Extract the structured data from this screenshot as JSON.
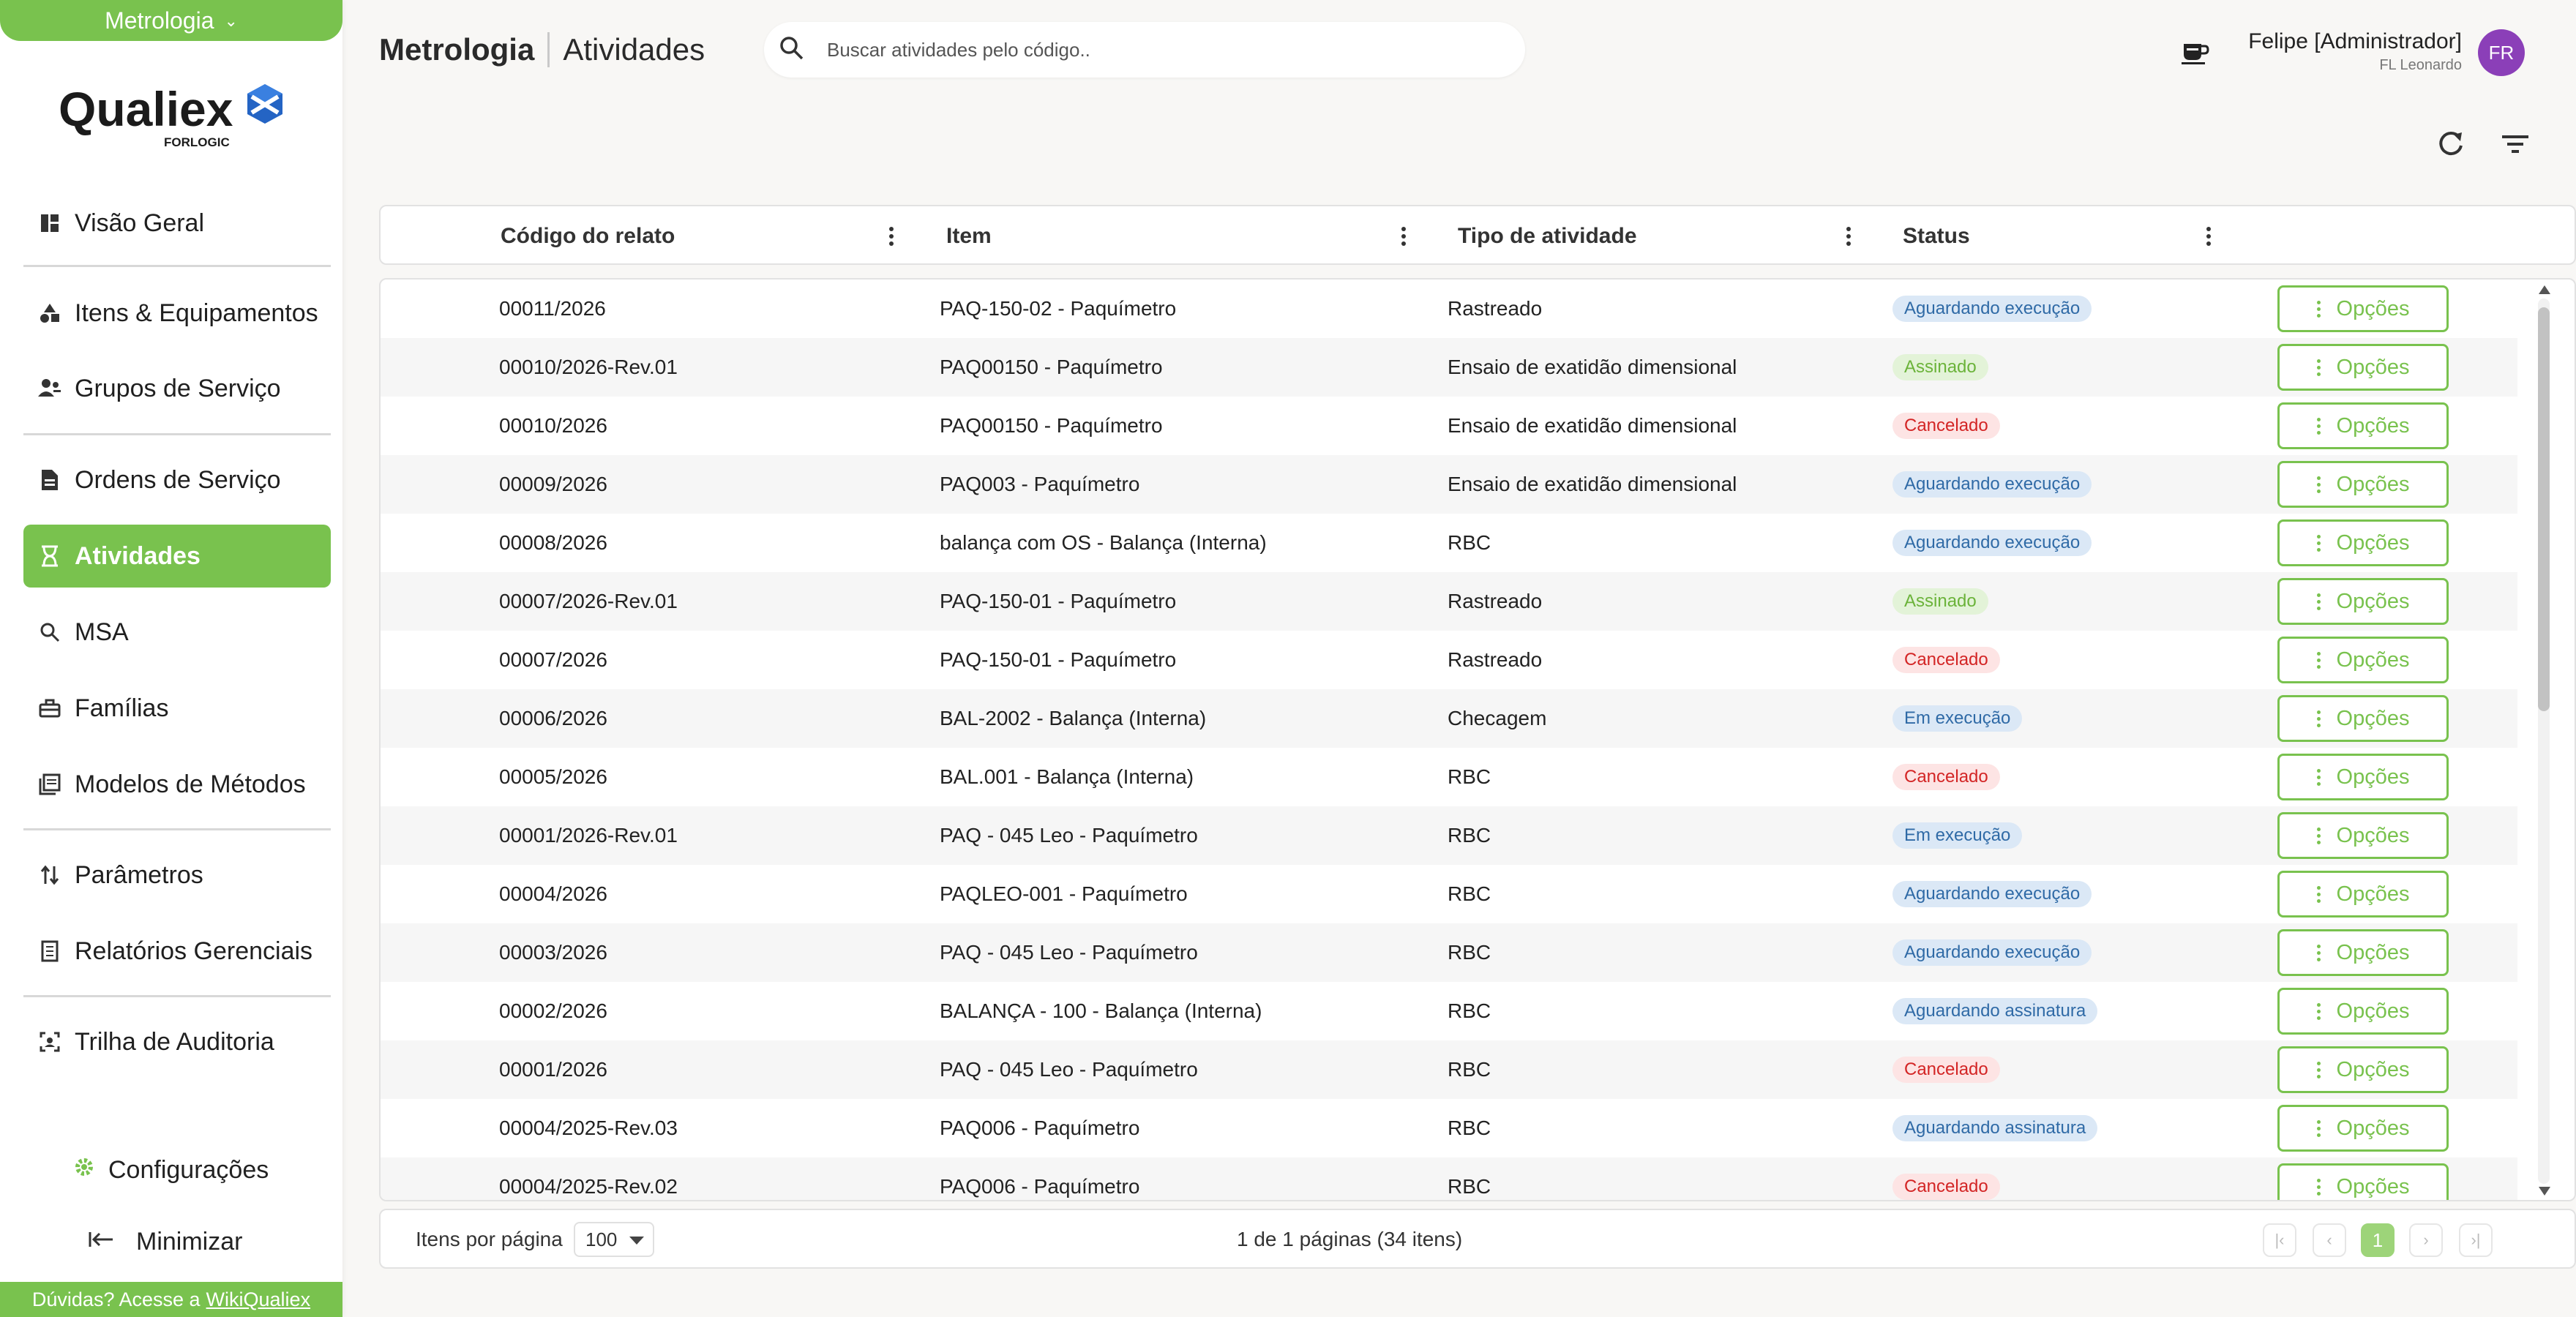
{
  "sidebar": {
    "module_label": "Metrologia",
    "logo": {
      "name": "Qualiex",
      "sub": "FORLOGIC"
    },
    "items": [
      {
        "label": "Visão Geral",
        "icon": "dashboard-icon"
      },
      {
        "label": "Itens & Equipamentos",
        "icon": "shapes-icon"
      },
      {
        "label": "Grupos de Serviço",
        "icon": "group-icon"
      },
      {
        "label": "Ordens de Serviço",
        "icon": "document-icon"
      },
      {
        "label": "Atividades",
        "icon": "hourglass-icon"
      },
      {
        "label": "MSA",
        "icon": "magnify-icon"
      },
      {
        "label": "Famílias",
        "icon": "toolbox-icon"
      },
      {
        "label": "Modelos de Métodos",
        "icon": "library-icon"
      },
      {
        "label": "Parâmetros",
        "icon": "sort-arrows-icon"
      },
      {
        "label": "Relatórios Gerenciais",
        "icon": "report-icon"
      },
      {
        "label": "Trilha de Auditoria",
        "icon": "audit-icon"
      }
    ],
    "active_item": "Atividades",
    "settings_label": "Configurações",
    "minimize_label": "Minimizar",
    "help_text": "Dúvidas? Acesse a",
    "help_link": "WikiQualiex"
  },
  "header": {
    "module": "Metrologia",
    "page": "Atividades",
    "search_placeholder": "Buscar atividades pelo código..",
    "user_name": "Felipe [Administrador]",
    "user_company": "FL Leonardo",
    "avatar_initials": "FR"
  },
  "table": {
    "columns": [
      "Código do relato",
      "Item",
      "Tipo de atividade",
      "Status"
    ],
    "option_label": "Opções",
    "rows": [
      {
        "code": "00011/2026",
        "item": "PAQ-150-02 - Paquímetro",
        "type": "Rastreado",
        "status": "Aguardando execução",
        "status_kind": "aguardando"
      },
      {
        "code": "00010/2026-Rev.01",
        "item": "PAQ00150 - Paquímetro",
        "type": "Ensaio de exatidão dimensional",
        "status": "Assinado",
        "status_kind": "assinado"
      },
      {
        "code": "00010/2026",
        "item": "PAQ00150 - Paquímetro",
        "type": "Ensaio de exatidão dimensional",
        "status": "Cancelado",
        "status_kind": "cancelado"
      },
      {
        "code": "00009/2026",
        "item": "PAQ003 - Paquímetro",
        "type": "Ensaio de exatidão dimensional",
        "status": "Aguardando execução",
        "status_kind": "aguardando"
      },
      {
        "code": "00008/2026",
        "item": "balança com OS - Balança (Interna)",
        "type": "RBC",
        "status": "Aguardando execução",
        "status_kind": "aguardando"
      },
      {
        "code": "00007/2026-Rev.01",
        "item": "PAQ-150-01 - Paquímetro",
        "type": "Rastreado",
        "status": "Assinado",
        "status_kind": "assinado"
      },
      {
        "code": "00007/2026",
        "item": "PAQ-150-01 - Paquímetro",
        "type": "Rastreado",
        "status": "Cancelado",
        "status_kind": "cancelado"
      },
      {
        "code": "00006/2026",
        "item": "BAL-2002 - Balança (Interna)",
        "type": "Checagem",
        "status": "Em execução",
        "status_kind": "execucao"
      },
      {
        "code": "00005/2026",
        "item": "BAL.001 - Balança (Interna)",
        "type": "RBC",
        "status": "Cancelado",
        "status_kind": "cancelado"
      },
      {
        "code": "00001/2026-Rev.01",
        "item": "PAQ - 045 Leo - Paquímetro",
        "type": "RBC",
        "status": "Em execução",
        "status_kind": "execucao"
      },
      {
        "code": "00004/2026",
        "item": "PAQLEO-001 - Paquímetro",
        "type": "RBC",
        "status": "Aguardando execução",
        "status_kind": "aguardando"
      },
      {
        "code": "00003/2026",
        "item": "PAQ - 045 Leo - Paquímetro",
        "type": "RBC",
        "status": "Aguardando execução",
        "status_kind": "aguardando"
      },
      {
        "code": "00002/2026",
        "item": "BALANÇA - 100 - Balança (Interna)",
        "type": "RBC",
        "status": "Aguardando assinatura",
        "status_kind": "aguardando"
      },
      {
        "code": "00001/2026",
        "item": "PAQ - 045 Leo - Paquímetro",
        "type": "RBC",
        "status": "Cancelado",
        "status_kind": "cancelado"
      },
      {
        "code": "00004/2025-Rev.03",
        "item": "PAQ006 - Paquímetro",
        "type": "RBC",
        "status": "Aguardando assinatura",
        "status_kind": "aguardando"
      },
      {
        "code": "00004/2025-Rev.02",
        "item": "PAQ006 - Paquímetro",
        "type": "RBC",
        "status": "Cancelado",
        "status_kind": "cancelado"
      }
    ]
  },
  "pagination": {
    "per_page_label": "Itens por página",
    "per_page_value": "100",
    "info": "1 de 1 páginas (34 itens)",
    "current_page": "1"
  },
  "colors": {
    "accent": "#79c24e",
    "avatar": "#8b3fb8",
    "status_blue": "#2f6aa6",
    "status_green": "#6bb33a",
    "status_red": "#d32525"
  }
}
